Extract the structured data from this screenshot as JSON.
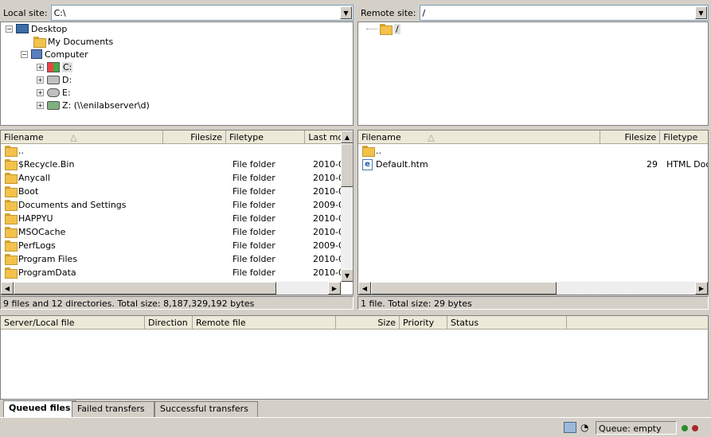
{
  "local": {
    "site_label": "Local site:",
    "path": "C:\\",
    "tree": [
      {
        "label": "Desktop",
        "icon": "desktop-icon"
      },
      {
        "label": "My Documents",
        "icon": "documents-icon"
      },
      {
        "label": "Computer",
        "icon": "computer-icon"
      },
      {
        "label": "C:",
        "icon": "windows-drive-icon"
      },
      {
        "label": "D:",
        "icon": "drive-icon"
      },
      {
        "label": "E:",
        "icon": "cdrom-icon"
      },
      {
        "label": "Z: (\\\\enilabserver\\d)",
        "icon": "network-drive-icon"
      }
    ],
    "columns": [
      "Filename",
      "Filesize",
      "Filetype",
      "Last mo"
    ],
    "files": [
      {
        "name": "..",
        "size": "",
        "type": "",
        "date": ""
      },
      {
        "name": "$Recycle.Bin",
        "size": "",
        "type": "File folder",
        "date": "2010-0"
      },
      {
        "name": "Anycall",
        "size": "",
        "type": "File folder",
        "date": "2010-0"
      },
      {
        "name": "Boot",
        "size": "",
        "type": "File folder",
        "date": "2010-0"
      },
      {
        "name": "Documents and Settings",
        "size": "",
        "type": "File folder",
        "date": "2009-0"
      },
      {
        "name": "HAPPYU",
        "size": "",
        "type": "File folder",
        "date": "2010-0"
      },
      {
        "name": "MSOCache",
        "size": "",
        "type": "File folder",
        "date": "2010-0"
      },
      {
        "name": "PerfLogs",
        "size": "",
        "type": "File folder",
        "date": "2009-0"
      },
      {
        "name": "Program Files",
        "size": "",
        "type": "File folder",
        "date": "2010-0"
      },
      {
        "name": "ProgramData",
        "size": "",
        "type": "File folder",
        "date": "2010-0"
      }
    ],
    "status": "9 files and 12 directories. Total size: 8,187,329,192 bytes"
  },
  "remote": {
    "site_label": "Remote site:",
    "path": "/",
    "tree_root": "/",
    "columns": [
      "Filename",
      "Filesize",
      "Filetype"
    ],
    "files": [
      {
        "name": "..",
        "size": "",
        "type": ""
      },
      {
        "name": "Default.htm",
        "size": "29",
        "type": "HTML Docu"
      }
    ],
    "status": "1 file. Total size: 29 bytes"
  },
  "queue": {
    "columns": [
      "Server/Local file",
      "Direction",
      "Remote file",
      "Size",
      "Priority",
      "Status"
    ],
    "tabs": [
      "Queued files",
      "Failed transfers",
      "Successful transfers"
    ],
    "status": "Queue: empty"
  },
  "colors": {
    "selected_bg": "#e0e0e0",
    "led_green": "#2e8b2e",
    "led_red": "#a52a2a"
  }
}
